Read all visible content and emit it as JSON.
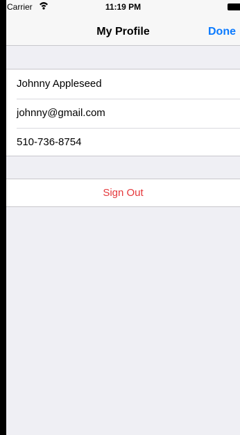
{
  "status_bar": {
    "carrier": "Carrier",
    "time": "11:19 PM"
  },
  "nav": {
    "title": "My Profile",
    "done_label": "Done"
  },
  "profile": {
    "rows": [
      {
        "value": "Johnny Appleseed"
      },
      {
        "value": "johnny@gmail.com"
      },
      {
        "value": "510-736-8754"
      }
    ]
  },
  "actions": {
    "sign_out_label": "Sign Out"
  },
  "colors": {
    "accent": "#0a7aff",
    "destructive": "#e5383b",
    "background": "#efeff4"
  }
}
